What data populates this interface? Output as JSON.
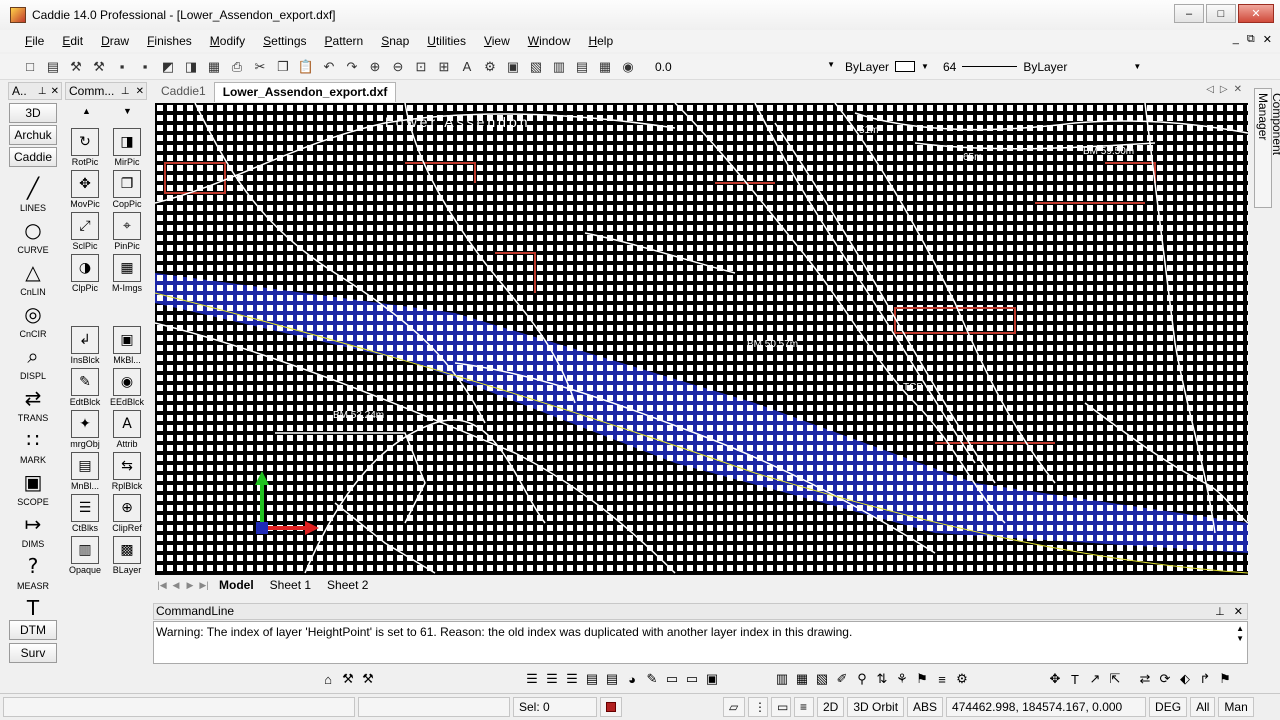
{
  "window": {
    "title": "Caddie 14.0 Professional - [Lower_Assendon_export.dxf]",
    "controls": [
      "–",
      "□",
      "✕"
    ],
    "mdi_controls": [
      "_",
      "⧉",
      "✕"
    ]
  },
  "menu": [
    "File",
    "Edit",
    "Draw",
    "Finishes",
    "Modify",
    "Settings",
    "Pattern",
    "Snap",
    "Utilities",
    "View",
    "Window",
    "Help"
  ],
  "toolbar": {
    "value": "0.0",
    "layer_color": "ByLayer",
    "line_weight": "64",
    "line_type": "ByLayer",
    "icons": [
      "new-icon",
      "open-icon",
      "tool-icon",
      "tool2-icon",
      "save-icon",
      "save-all-icon",
      "export-icon",
      "import-icon",
      "print-preview-icon",
      "print-icon",
      "cut-icon",
      "copy-icon",
      "paste-icon",
      "undo-icon",
      "redo-icon",
      "zoom-in-icon",
      "zoom-out-icon",
      "zoom-window-icon",
      "zoom-extents-icon",
      "text-icon",
      "settings-icon",
      "layers-icon",
      "views-icon",
      "sheets-icon",
      "book-icon",
      "clipboard-icon",
      "camera-icon"
    ]
  },
  "left_panel": {
    "header1": "A..",
    "header2": "Comm...",
    "categories": [
      "3D",
      "Archuk",
      "Caddie"
    ],
    "tools": [
      {
        "label": "LINES",
        "glyph": "╱"
      },
      {
        "label": "CURVE",
        "glyph": "○"
      },
      {
        "label": "CnLIN",
        "glyph": "△"
      },
      {
        "label": "CnCIR",
        "glyph": "◎"
      },
      {
        "label": "DISPL",
        "glyph": "⌕"
      },
      {
        "label": "TRANS",
        "glyph": "⇄"
      },
      {
        "label": "MARK",
        "glyph": "∷"
      },
      {
        "label": "SCOPE",
        "glyph": "▣"
      },
      {
        "label": "DIMS",
        "glyph": "↦"
      },
      {
        "label": "MEASR",
        "glyph": "?"
      },
      {
        "label": "",
        "glyph": "T"
      }
    ],
    "bottom_buttons": [
      "DTM",
      "Surv"
    ],
    "cmd_tools": [
      {
        "label": "RotPic",
        "glyph": "↻"
      },
      {
        "label": "MirPic",
        "glyph": "◨"
      },
      {
        "label": "MovPic",
        "glyph": "✥"
      },
      {
        "label": "CopPic",
        "glyph": "❐"
      },
      {
        "label": "SclPic",
        "glyph": "⤢"
      },
      {
        "label": "PinPic",
        "glyph": "⌖"
      },
      {
        "label": "ClpPic",
        "glyph": "◑"
      },
      {
        "label": "M-Imgs",
        "glyph": "▦"
      },
      {
        "label": "InsBlck",
        "glyph": "↲"
      },
      {
        "label": "MkBl...",
        "glyph": "▣"
      },
      {
        "label": "EdtBlck",
        "glyph": "✎"
      },
      {
        "label": "EEdBlck",
        "glyph": "◉"
      },
      {
        "label": "mrgObj",
        "glyph": "✦"
      },
      {
        "label": "Attrib",
        "glyph": "A"
      },
      {
        "label": "MnBl...",
        "glyph": "▤"
      },
      {
        "label": "RplBlck",
        "glyph": "⇆"
      },
      {
        "label": "CtBlks",
        "glyph": "☰"
      },
      {
        "label": "ClipRef",
        "glyph": "⊕"
      },
      {
        "label": "Opaque",
        "glyph": "▥"
      },
      {
        "label": "BLayer",
        "glyph": "▩"
      }
    ]
  },
  "document": {
    "tabs": [
      "Caddie1",
      "Lower_Assendon_export.dxf"
    ],
    "active_tab": "Lower_Assendon_export.dxf",
    "tab_controls": [
      "◁",
      "▷",
      "✕"
    ]
  },
  "drawing_labels": [
    {
      "text": "Lower Assendon",
      "color": "#ffffff"
    },
    {
      "text": "BM 59.50m",
      "color": "#ffffff"
    },
    {
      "text": "BM 50.57m",
      "color": "#ffffff"
    },
    {
      "text": "BM 53.24m",
      "color": "#ffffff"
    },
    {
      "text": "TCB",
      "color": "#ffffff"
    },
    {
      "text": "51m",
      "color": "#ffffff"
    },
    {
      "text": "65m",
      "color": "#ffffff"
    }
  ],
  "sheets": [
    "Model",
    "Sheet 1",
    "Sheet 2"
  ],
  "active_sheet": "Model",
  "component_manager": "Component Manager",
  "command_line": {
    "title": "CommandLine",
    "message": "Warning: The index of layer 'HeightPoint' is set to 61. Reason: the old index was duplicated with another layer index in this drawing."
  },
  "status": {
    "selection": "Sel: 0",
    "mode_2d": "2D",
    "orbit": "3D Orbit",
    "abs": "ABS",
    "coordinates": "474462.998, 184574.167, 0.000",
    "units": "DEG",
    "all": "All",
    "man": "Man"
  },
  "colors": {
    "canvas_bg": "#000000",
    "grid_dot": "#ffffff",
    "contour_blue": "#1f2ab8",
    "feature_red": "#c0392b",
    "axis_green": "#1fc21f",
    "axis_red": "#e02020"
  }
}
